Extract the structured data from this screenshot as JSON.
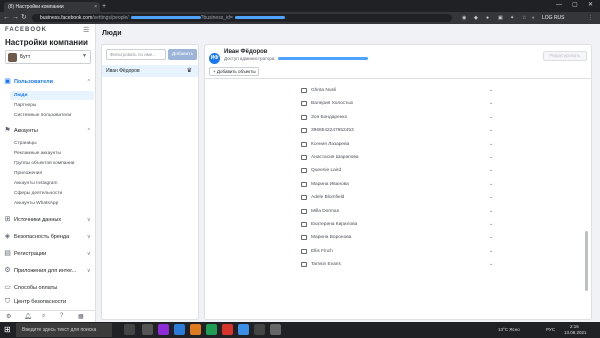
{
  "browser": {
    "tab_title": "(8) Настройки компании",
    "tab_close": "×",
    "new_tab": "+",
    "url_host": "business.facebook.com",
    "url_path": "/settings/people/",
    "url_tail": "?business_id=",
    "back": "←",
    "forward": "→",
    "reload": "↻",
    "account_button": "LOG RUS",
    "win_min": "—",
    "win_max": "▢",
    "win_close": "✕"
  },
  "sidebar": {
    "logo": "FACEBOOK",
    "title": "Настройки компании",
    "account_name": "Бутт",
    "sections": [
      {
        "label": "Пользователи",
        "icon": "users-icon"
      },
      {
        "label": "Аккаунты",
        "icon": "flag-icon"
      },
      {
        "label": "Источники данных",
        "icon": "data-source-icon"
      },
      {
        "label": "Безопасность бренда",
        "icon": "shield-icon"
      },
      {
        "label": "Регистрации",
        "icon": "registration-icon"
      },
      {
        "label": "Приложения для интег...",
        "icon": "integrations-icon"
      },
      {
        "label": "Способы оплаты",
        "icon": "payment-icon"
      },
      {
        "label": "Центр безопасности",
        "icon": "security-center-icon"
      }
    ],
    "users_sub": [
      "Люди",
      "Партнеры",
      "Системные пользователи"
    ],
    "accounts_sub": [
      "Страницы",
      "Рекламные аккаунты",
      "Группы объектов компании",
      "Приложения",
      "Аккаунты Instagram",
      "Сферы деятельности",
      "Аккаунты WhatsApp"
    ]
  },
  "main": {
    "title": "Люди",
    "search_placeholder": "Фильтровать по име...",
    "add_button": "Добавить",
    "people": [
      {
        "name": "Иван Фёдоров"
      }
    ],
    "detail": {
      "avatar_initials": "ИФ",
      "name": "Иван Фёдоров",
      "role": "Доступ администратора:",
      "add_assets": "Добавить объекты",
      "edit_button": "Редактировать"
    },
    "assets": [
      "Ghnta Nusli",
      "Валерия Холостых",
      "Зоя Бондаренко",
      "3968542247852453",
      "Ксения Лазарева",
      "Анастасия Шарапова",
      "Queenie Laird",
      "Марина Иванова",
      "Adele Blomfield",
      "Milla Dorman",
      "Екатерина Кирилова",
      "Марина Воронова",
      "Ellis Finch",
      "Tamsin Evans"
    ]
  },
  "taskbar": {
    "search_placeholder": "Введите здесь текст для поиска",
    "weather": "13°C Ясно",
    "lang": "РУС",
    "time": "2:16",
    "date": "13.08.2021"
  }
}
